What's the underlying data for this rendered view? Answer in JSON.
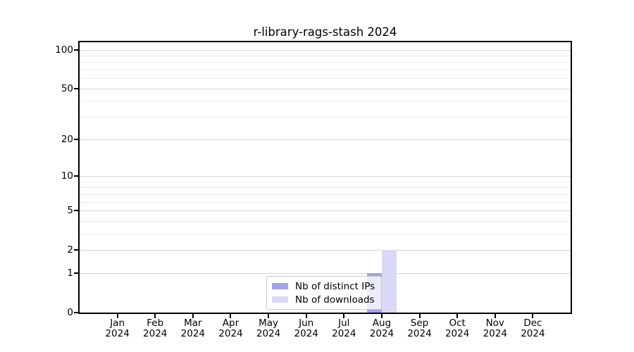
{
  "title": "r-library-rags-stash 2024",
  "chart_data": {
    "type": "bar",
    "title": "r-library-rags-stash 2024",
    "categories": [
      "Jan",
      "Feb",
      "Mar",
      "Apr",
      "May",
      "Jun",
      "Jul",
      "Aug",
      "Sep",
      "Oct",
      "Nov",
      "Dec"
    ],
    "category_year": "2024",
    "series": [
      {
        "name": "Nb of distinct IPs",
        "color": "#a2a2ee",
        "values": [
          0,
          0,
          0,
          0,
          0,
          0,
          0,
          1,
          0,
          0,
          0,
          0
        ]
      },
      {
        "name": "Nb of downloads",
        "color": "#d9d9f7",
        "values": [
          0,
          0,
          0,
          0,
          0,
          0,
          0,
          2,
          0,
          0,
          0,
          0
        ]
      }
    ],
    "yscale": "log1p",
    "ylim": [
      0,
      114
    ],
    "yticks": [
      0,
      1,
      2,
      5,
      10,
      20,
      50,
      100
    ],
    "minor_yticks": [
      3,
      4,
      6,
      7,
      8,
      9,
      30,
      40,
      60,
      70,
      80,
      90
    ],
    "grid": true,
    "legend_position": "inside-bottom-center",
    "colors": {
      "major_grid": "#d4d4d4",
      "minor_grid": "#eeeeee",
      "axis": "#000000",
      "background": "#ffffff"
    }
  }
}
